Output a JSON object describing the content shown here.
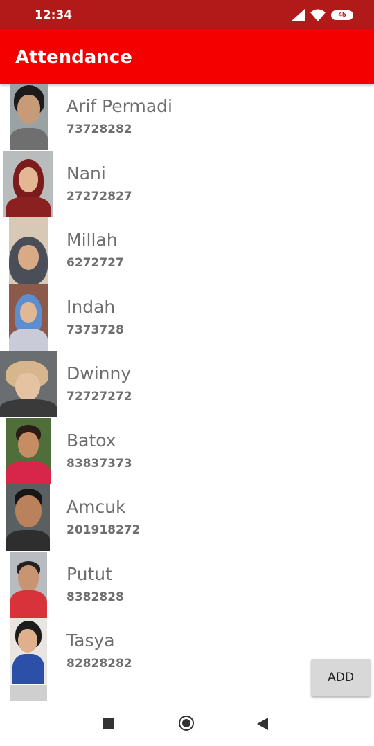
{
  "status_bar": {
    "time": "12:34",
    "battery": "45"
  },
  "app_bar": {
    "title": "Attendance"
  },
  "students": [
    {
      "name": "Arif Permadi",
      "id": "73728282"
    },
    {
      "name": "Nani",
      "id": "27272827"
    },
    {
      "name": "Millah",
      "id": "6272727"
    },
    {
      "name": "Indah",
      "id": "7373728"
    },
    {
      "name": "Dwinny",
      "id": "72727272"
    },
    {
      "name": "Batox",
      "id": "83837373"
    },
    {
      "name": "Amcuk",
      "id": "201918272"
    },
    {
      "name": "Putut",
      "id": "8382828"
    },
    {
      "name": "Tasya",
      "id": "82828282"
    }
  ],
  "add_button": {
    "label": "ADD"
  },
  "colors": {
    "status_bar": "#b21a1a",
    "app_bar": "#f40000",
    "text": "#6e6e6e"
  },
  "icons": {
    "nav": [
      "recents-square-icon",
      "home-circle-icon",
      "back-triangle-icon"
    ]
  }
}
